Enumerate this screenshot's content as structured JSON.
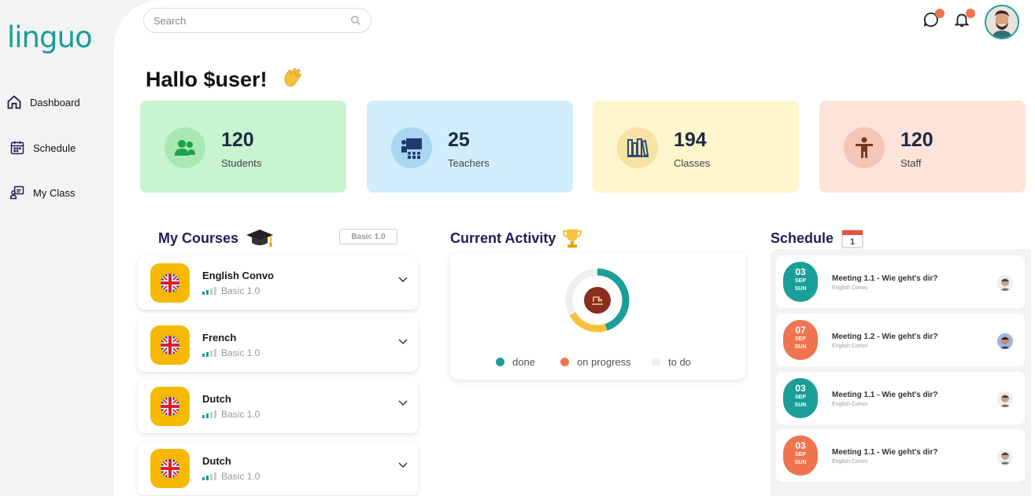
{
  "app": {
    "logo": "linguo"
  },
  "sidebar": {
    "items": [
      {
        "label": "Dashboard",
        "icon": "home-icon"
      },
      {
        "label": "Schedule",
        "icon": "calendar-icon"
      },
      {
        "label": "My Class",
        "icon": "class-icon"
      }
    ]
  },
  "header": {
    "search_placeholder": "Search",
    "chat_icon": "chat-icon",
    "bell_icon": "bell-icon"
  },
  "greeting": "Hallo $user!",
  "stats": [
    {
      "value": "120",
      "label": "Students",
      "bg": "#c8f5cf",
      "circle": "#a8e8b4",
      "icon": "students-icon"
    },
    {
      "value": "25",
      "label": "Teachers",
      "bg": "#d0eefb",
      "circle": "#a9d6f1",
      "icon": "teacher-icon"
    },
    {
      "value": "194",
      "label": "Classes",
      "bg": "#fef6cc",
      "circle": "#f6e3a5",
      "icon": "books-icon"
    },
    {
      "value": "120",
      "label": "Staff",
      "bg": "#fde3d9",
      "circle": "#f5c6b8",
      "icon": "staff-icon"
    }
  ],
  "courses": {
    "title": "My Courses",
    "badge": "Basic 1.0",
    "items": [
      {
        "name": "English Convo",
        "level": "Basic 1.0"
      },
      {
        "name": "French",
        "level": "Basic 1.0"
      },
      {
        "name": "Dutch",
        "level": "Basic 1.0"
      },
      {
        "name": "Dutch",
        "level": "Basic 1.0"
      }
    ]
  },
  "activity": {
    "title": "Current Activity",
    "legend": [
      {
        "label": "done",
        "color": "#1a9e97"
      },
      {
        "label": "on progress",
        "color": "#f07350"
      },
      {
        "label": "to do",
        "color": "#eeeeee"
      }
    ],
    "donut": {
      "done": 0.45,
      "on_progress": 0.22,
      "to_do": 0.33
    }
  },
  "schedule": {
    "title": "Schedule",
    "items": [
      {
        "day": "03",
        "month": "SEP",
        "dow": "SUN",
        "color": "#1a9e97",
        "title": "Meeting 1.1 - Wie geht's dir?",
        "course": "English Convo"
      },
      {
        "day": "07",
        "month": "SEP",
        "dow": "SUN",
        "color": "#f07350",
        "title": "Meeting 1.2 - Wie geht's dir?",
        "course": "English Convo"
      },
      {
        "day": "03",
        "month": "SEP",
        "dow": "SUN",
        "color": "#1a9e97",
        "title": "Meeting 1.1 - Wie geht's dir?",
        "course": "English Convo"
      },
      {
        "day": "03",
        "month": "SEP",
        "dow": "SUN",
        "color": "#f07350",
        "title": "Meeting 1.1 - Wie geht's dir?",
        "course": "English Convo"
      }
    ]
  }
}
